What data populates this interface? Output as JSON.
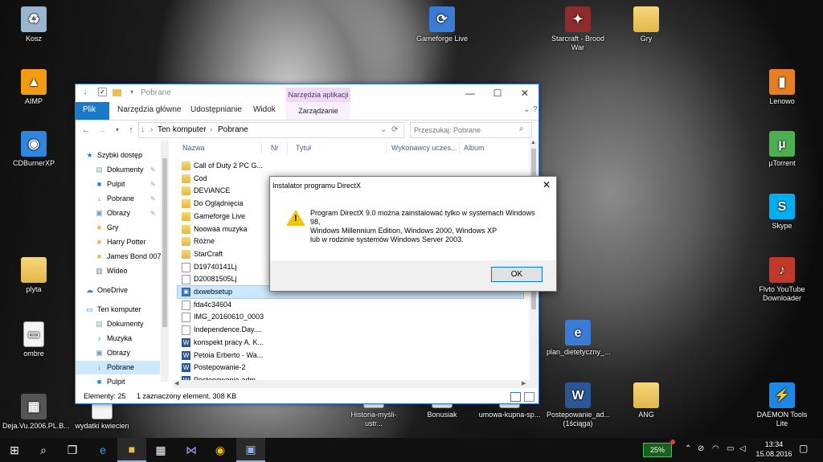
{
  "desktop": {
    "icons": [
      {
        "label": "Kosz",
        "glyph": "♻",
        "color": "#9ab6cf",
        "kind": "recycle-bin"
      },
      {
        "label": "AIMP",
        "glyph": "▲",
        "color": "#f39c12",
        "kind": "aimp"
      },
      {
        "label": "CDBurnerXP",
        "glyph": "◉",
        "color": "#2e86de",
        "kind": "cdburner"
      },
      {
        "label": "plyta",
        "glyph": "",
        "color": "",
        "kind": "folder"
      },
      {
        "label": "ombre",
        "glyph": "▭",
        "color": "#e8e8e8",
        "kind": "file"
      },
      {
        "label": "Deja.Vu.2006.PL.B...",
        "glyph": "▦",
        "color": "#555",
        "kind": "video"
      },
      {
        "label": "wydatki kwiecien",
        "glyph": "",
        "color": "#222",
        "kind": "file"
      },
      {
        "label": "Gameforge Live",
        "glyph": "⟳",
        "color": "#3a7bd5",
        "kind": "gameforge"
      },
      {
        "label": "Starcraft - Brood War",
        "glyph": "✦",
        "color": "#8e2c2c",
        "kind": "starcraft"
      },
      {
        "label": "Gry",
        "glyph": "",
        "color": "",
        "kind": "folder"
      },
      {
        "label": "Lenowo",
        "glyph": "▮",
        "color": "#e67e22",
        "kind": "lenowo"
      },
      {
        "label": "µTorrent",
        "glyph": "µ",
        "color": "#4caf50",
        "kind": "utorrent"
      },
      {
        "label": "Skype",
        "glyph": "S",
        "color": "#00aff0",
        "kind": "skype"
      },
      {
        "label": "Flvto YouTube Downloader",
        "glyph": "♪",
        "color": "#c0392b",
        "kind": "flvto"
      },
      {
        "label": "plan_dietetyczny_...",
        "glyph": "e",
        "color": "#3a7bd5",
        "kind": "pdf"
      },
      {
        "label": "Historia-myśli-ustr...",
        "glyph": "",
        "color": "",
        "kind": "file"
      },
      {
        "label": "Bonusiak",
        "glyph": "",
        "color": "",
        "kind": "file"
      },
      {
        "label": "umowa-kupna-sp...",
        "glyph": "",
        "color": "",
        "kind": "file"
      },
      {
        "label": "Postepowanie_ad... (1ściąga)",
        "glyph": "W",
        "color": "#2b5797",
        "kind": "word"
      },
      {
        "label": "ANG",
        "glyph": "",
        "color": "",
        "kind": "folder"
      },
      {
        "label": "DAEMON Tools Lite",
        "glyph": "⚡",
        "color": "#1e88e5",
        "kind": "daemon"
      }
    ]
  },
  "explorer": {
    "title": "Pobrane",
    "ribbon": {
      "file_tab": "Plik",
      "tabs": [
        "Narzędzia główne",
        "Udostępnianie",
        "Widok"
      ],
      "context_header": "Narzędzia aplikacji",
      "context_tab": "Zarządzanie"
    },
    "address": {
      "root": "Ten komputer",
      "current": "Pobrane"
    },
    "search_placeholder": "Przeszukaj: Pobrane",
    "nav": [
      {
        "label": "Szybki dostęp",
        "icon": "star-icon",
        "glyph": "★",
        "color": "#2b7cd3",
        "pinned": false,
        "selected": false
      },
      {
        "label": "Dokumenty",
        "icon": "documents-icon",
        "glyph": "▤",
        "color": "#8aa",
        "pinned": true,
        "selected": false
      },
      {
        "label": "Pulpit",
        "icon": "desktop-icon",
        "glyph": "■",
        "color": "#1e88e5",
        "pinned": true,
        "selected": false
      },
      {
        "label": "Pobrane",
        "icon": "download-icon",
        "glyph": "↓",
        "color": "#2b7cd3",
        "pinned": true,
        "selected": false
      },
      {
        "label": "Obrazy",
        "icon": "pictures-icon",
        "glyph": "▣",
        "color": "#7a9ab8",
        "pinned": true,
        "selected": false
      },
      {
        "label": "Gry",
        "icon": "folder-icon",
        "glyph": "■",
        "color": "#e8be55",
        "pinned": false,
        "selected": false
      },
      {
        "label": "Harry Potter",
        "icon": "folder-icon",
        "glyph": "■",
        "color": "#e8be55",
        "pinned": false,
        "selected": false
      },
      {
        "label": "James Bond 007",
        "icon": "folder-icon",
        "glyph": "■",
        "color": "#e8be55",
        "pinned": false,
        "selected": false
      },
      {
        "label": "Wideo",
        "icon": "video-icon",
        "glyph": "▥",
        "color": "#6f7f8f",
        "pinned": false,
        "selected": false
      },
      {
        "label": "OneDrive",
        "icon": "cloud-icon",
        "glyph": "☁",
        "color": "#1e88e5",
        "pinned": false,
        "selected": false
      },
      {
        "label": "Ten komputer",
        "icon": "computer-icon",
        "glyph": "▭",
        "color": "#3b78c4",
        "pinned": false,
        "selected": false
      },
      {
        "label": "Dokumenty",
        "icon": "documents-icon",
        "glyph": "▤",
        "color": "#8aa",
        "pinned": false,
        "selected": false
      },
      {
        "label": "Muzyka",
        "icon": "music-icon",
        "glyph": "♪",
        "color": "#2b7cd3",
        "pinned": false,
        "selected": false
      },
      {
        "label": "Obrazy",
        "icon": "pictures-icon",
        "glyph": "▣",
        "color": "#7a9ab8",
        "pinned": false,
        "selected": false
      },
      {
        "label": "Pobrane",
        "icon": "download-icon",
        "glyph": "↓",
        "color": "#2b7cd3",
        "pinned": false,
        "selected": true
      },
      {
        "label": "Pulpit",
        "icon": "desktop-icon",
        "glyph": "■",
        "color": "#1e88e5",
        "pinned": false,
        "selected": false
      }
    ],
    "columns": [
      "Nazwa",
      "Nr",
      "Tytuł",
      "Wykonawcy uczes...",
      "Album"
    ],
    "files": [
      {
        "name": "Call of Duty 2 PC G...",
        "type": "folder",
        "selected": false
      },
      {
        "name": "Cod",
        "type": "folder",
        "selected": false
      },
      {
        "name": "DEViANCE",
        "type": "folder",
        "selected": false
      },
      {
        "name": "Do Oglądnięcia",
        "type": "folder",
        "selected": false
      },
      {
        "name": "Gameforge Live",
        "type": "folder",
        "selected": false
      },
      {
        "name": "Noowaa muzyka",
        "type": "folder",
        "selected": false
      },
      {
        "name": "Różne",
        "type": "folder",
        "selected": false
      },
      {
        "name": "StarCraft",
        "type": "folder",
        "selected": false
      },
      {
        "name": "D19740141Lj",
        "type": "file",
        "selected": false
      },
      {
        "name": "D20081505Lj",
        "type": "file",
        "selected": false
      },
      {
        "name": "dxwebsetup",
        "type": "app",
        "selected": true
      },
      {
        "name": "fda4c34604",
        "type": "file",
        "selected": false
      },
      {
        "name": "IMG_20160610_0003",
        "type": "file",
        "selected": false
      },
      {
        "name": "Independence.Day....",
        "type": "file",
        "selected": false
      },
      {
        "name": "konspekt pracy A. K...",
        "type": "doc",
        "selected": false
      },
      {
        "name": "Petoia Erberto - Wa...",
        "type": "doc",
        "selected": false
      },
      {
        "name": "Postepowanie-2",
        "type": "doc",
        "selected": false
      },
      {
        "name": "Postepowanie-adm...",
        "type": "doc",
        "selected": false
      }
    ],
    "status": {
      "count": "Elementy: 25",
      "selection": "1 zaznaczony element. 308 KB"
    }
  },
  "dialog": {
    "title": "Instalator programu DirectX",
    "message": "Program DirectX 9.0 można zainstalować tylko w systemach Windows 98,\nWindows Millennium Edition, Windows 2000, Windows XP\nlub w rodzinie systemów Windows Server 2003.",
    "ok_label": "OK"
  },
  "taskbar": {
    "battery": "25%",
    "time": "13:34",
    "date": "15.08.2016"
  },
  "colors": {
    "accent": "#1979ca",
    "selection": "#cce8ff",
    "context_tab": "#f3d6fb"
  }
}
